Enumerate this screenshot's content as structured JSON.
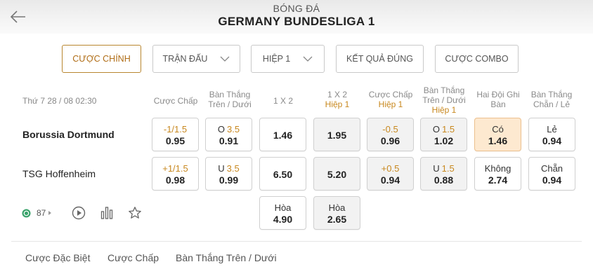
{
  "header": {
    "sport": "BÓNG ĐÁ",
    "league": "GERMANY BUNDESLIGA 1"
  },
  "tabs": [
    {
      "label": "CƯỢC CHÍNH",
      "active": true
    },
    {
      "label": "TRẬN ĐẤU",
      "dropdown": true
    },
    {
      "label": "HIỆP 1",
      "dropdown": true
    },
    {
      "label": "KẾT QUẢ ĐÚNG"
    },
    {
      "label": "CƯỢC COMBO"
    }
  ],
  "match": {
    "time": "Thứ 7 28 / 08 02:30",
    "home": "Borussia Dortmund",
    "away": "TSG Hoffenheim",
    "live_count": "87"
  },
  "columns": {
    "handicap": "Cược Chấp",
    "ou": "Bàn Thắng Trên / Dưới",
    "x12": "1 X 2",
    "x12_h1": "1 X 2",
    "handicap_h1": "Cược Chấp",
    "ou_h1": "Bàn Thắng Trên / Dưới",
    "h1_sub": "Hiệp 1",
    "btts": "Hai Đội Ghi Bàn",
    "oddeven": "Bàn Thắng Chẵn / Lẻ"
  },
  "odds": {
    "home": {
      "hdp_line": "-1/1.5",
      "hdp_odd": "0.95",
      "ou_tag": "O",
      "ou_line": "3.5",
      "ou_odd": "0.91",
      "x12": "1.46",
      "x12_h1": "1.95",
      "hdp_h1_line": "-0.5",
      "hdp_h1_odd": "0.96",
      "ou_h1_tag": "O",
      "ou_h1_line": "1.5",
      "ou_h1_odd": "1.02",
      "btts_label": "Có",
      "btts_odd": "1.46",
      "oe_label": "Lẻ",
      "oe_odd": "0.94"
    },
    "away": {
      "hdp_line": "+1/1.5",
      "hdp_odd": "0.98",
      "ou_tag": "U",
      "ou_line": "3.5",
      "ou_odd": "0.99",
      "x12": "6.50",
      "x12_h1": "5.20",
      "hdp_h1_line": "+0.5",
      "hdp_h1_odd": "0.94",
      "ou_h1_tag": "U",
      "ou_h1_line": "1.5",
      "ou_h1_odd": "0.88",
      "btts_label": "Không",
      "btts_odd": "2.74",
      "oe_label": "Chẵn",
      "oe_odd": "0.94"
    },
    "draw": {
      "label": "Hòa",
      "x12": "4.90",
      "label_h1": "Hòa",
      "x12_h1": "2.65"
    }
  },
  "bottom_tabs": [
    "Cược Đặc Biệt",
    "Cược Chấp",
    "Bàn Thắng Trên / Dưới"
  ],
  "colors": {
    "accent": "#c8881f",
    "selected_bg": "#fde9d0",
    "border": "#d0d0d0"
  }
}
